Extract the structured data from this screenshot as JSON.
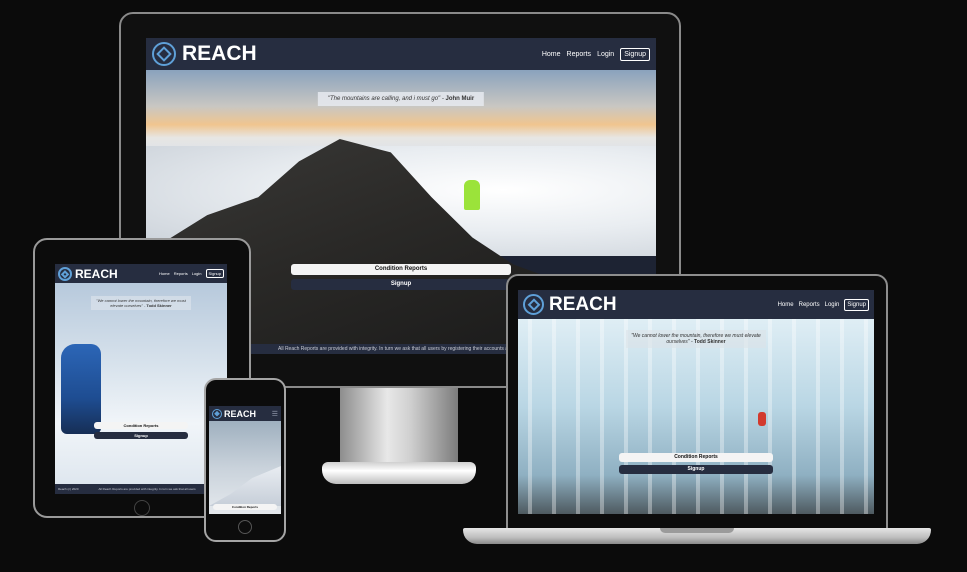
{
  "brand": {
    "name": "REACH",
    "accent": "#5fa0d8",
    "nav_bg": "#262d40"
  },
  "nav": {
    "home": "Home",
    "reports": "Reports",
    "login": "Login",
    "signup": "Signup"
  },
  "monitor": {
    "quote_text": "\"The mountains are calling, and i must go\" -",
    "quote_author": "John Muir",
    "btn_reports": "Condition Reports",
    "btn_signup": "Signup",
    "footer": "All Reach Reports are provided with integrity. In turn we ask that all users by registering their accounts agree"
  },
  "tablet": {
    "quote_text": "\"We cannot lower the mountain, therefore we must elevate ourselves\" -",
    "quote_author": "Todd Skinner",
    "btn_reports": "Condition Reports",
    "btn_signup": "Signup",
    "footer_left": "Reach (c) 2020",
    "footer_right": "All Reach Reports are provided with integrity. In turn we ask that all users"
  },
  "phone": {
    "btn_reports": "Condition Reports"
  },
  "laptop": {
    "quote_text": "\"We cannot lower the mountain, therefore we must elevate ourselves\" -",
    "quote_author": "Todd Skinner",
    "btn_reports": "Condition Reports",
    "btn_signup": "Signup"
  }
}
